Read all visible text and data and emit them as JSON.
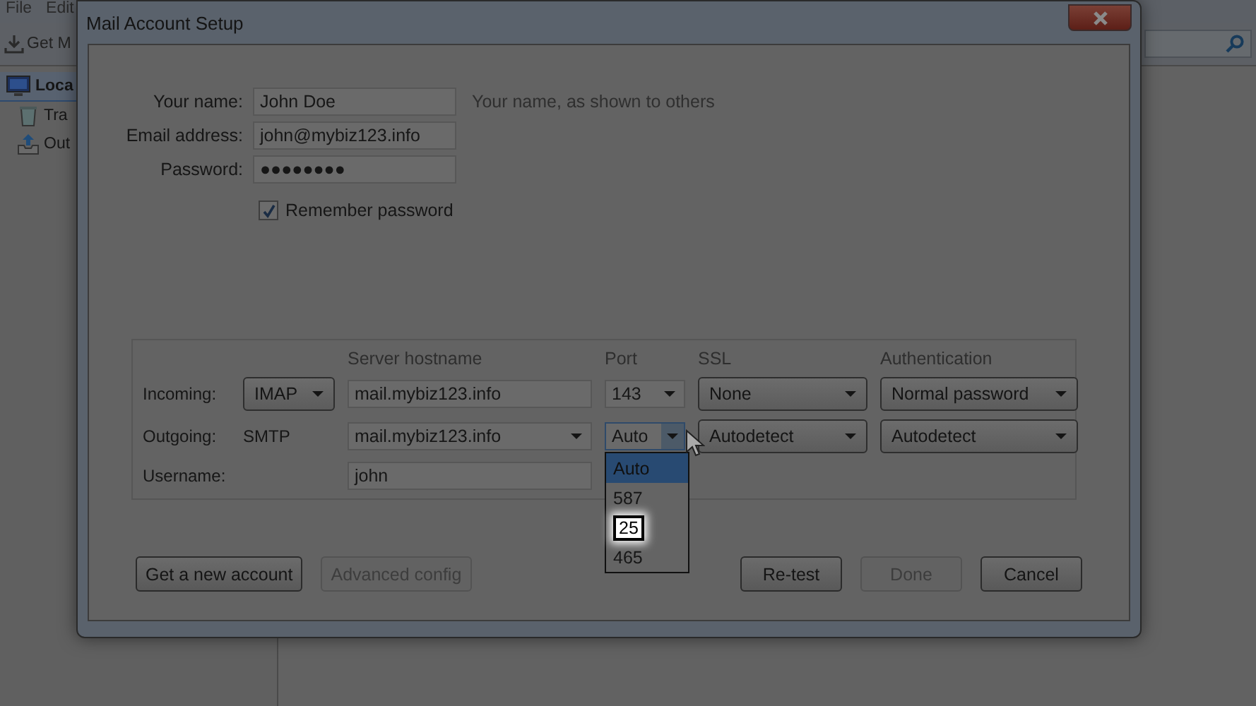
{
  "app": {
    "menu": [
      {
        "label": "File"
      },
      {
        "label": "Edit"
      }
    ],
    "toolbar": {
      "get_button": "Get M"
    },
    "folders": [
      {
        "label": "Loca",
        "kind": "local",
        "selected": true,
        "children": [
          {
            "label": "Tra",
            "kind": "trash",
            "selected": false
          },
          {
            "label": "Out",
            "kind": "outbox",
            "selected": false
          }
        ]
      }
    ]
  },
  "dialog": {
    "title": "Mail Account Setup",
    "identity": [
      {
        "label": "Your name:",
        "value": "John Doe",
        "hint": "Your name, as shown to others"
      },
      {
        "label": "Email address:",
        "value": "john@mybiz123.info"
      },
      {
        "label": "Password:",
        "value": "●●●●●●●●"
      }
    ],
    "remember": {
      "label": "Remember password",
      "checked": true
    },
    "server": {
      "headers": {
        "hostname": "Server hostname",
        "port": "Port",
        "ssl": "SSL",
        "auth": "Authentication"
      },
      "rows": [
        {
          "kind": "incoming",
          "label": "Incoming:",
          "protocol": "IMAP",
          "hostname": "mail.mybiz123.info",
          "port": "143",
          "ssl": "None",
          "auth": "Normal password"
        },
        {
          "kind": "outgoing",
          "label": "Outgoing:",
          "protocol": "SMTP",
          "hostname": "mail.mybiz123.info",
          "port": "Auto",
          "ssl": "Autodetect",
          "auth": "Autodetect",
          "port_options": [
            {
              "label": "Auto",
              "selected": true,
              "highlighted": false
            },
            {
              "label": "587",
              "selected": false,
              "highlighted": false
            },
            {
              "label": "25",
              "selected": false,
              "highlighted": true
            },
            {
              "label": "465",
              "selected": false,
              "highlighted": false
            }
          ]
        },
        {
          "kind": "username",
          "label": "Username:",
          "hostname": "john"
        }
      ]
    },
    "buttons_left": [
      {
        "label": "Get a new account",
        "disabled": false
      },
      {
        "label": "Advanced config",
        "disabled": true
      }
    ],
    "buttons_right": [
      {
        "label": "Re-test",
        "disabled": false
      },
      {
        "label": "Done",
        "disabled": true
      },
      {
        "label": "Cancel",
        "disabled": false
      }
    ]
  }
}
